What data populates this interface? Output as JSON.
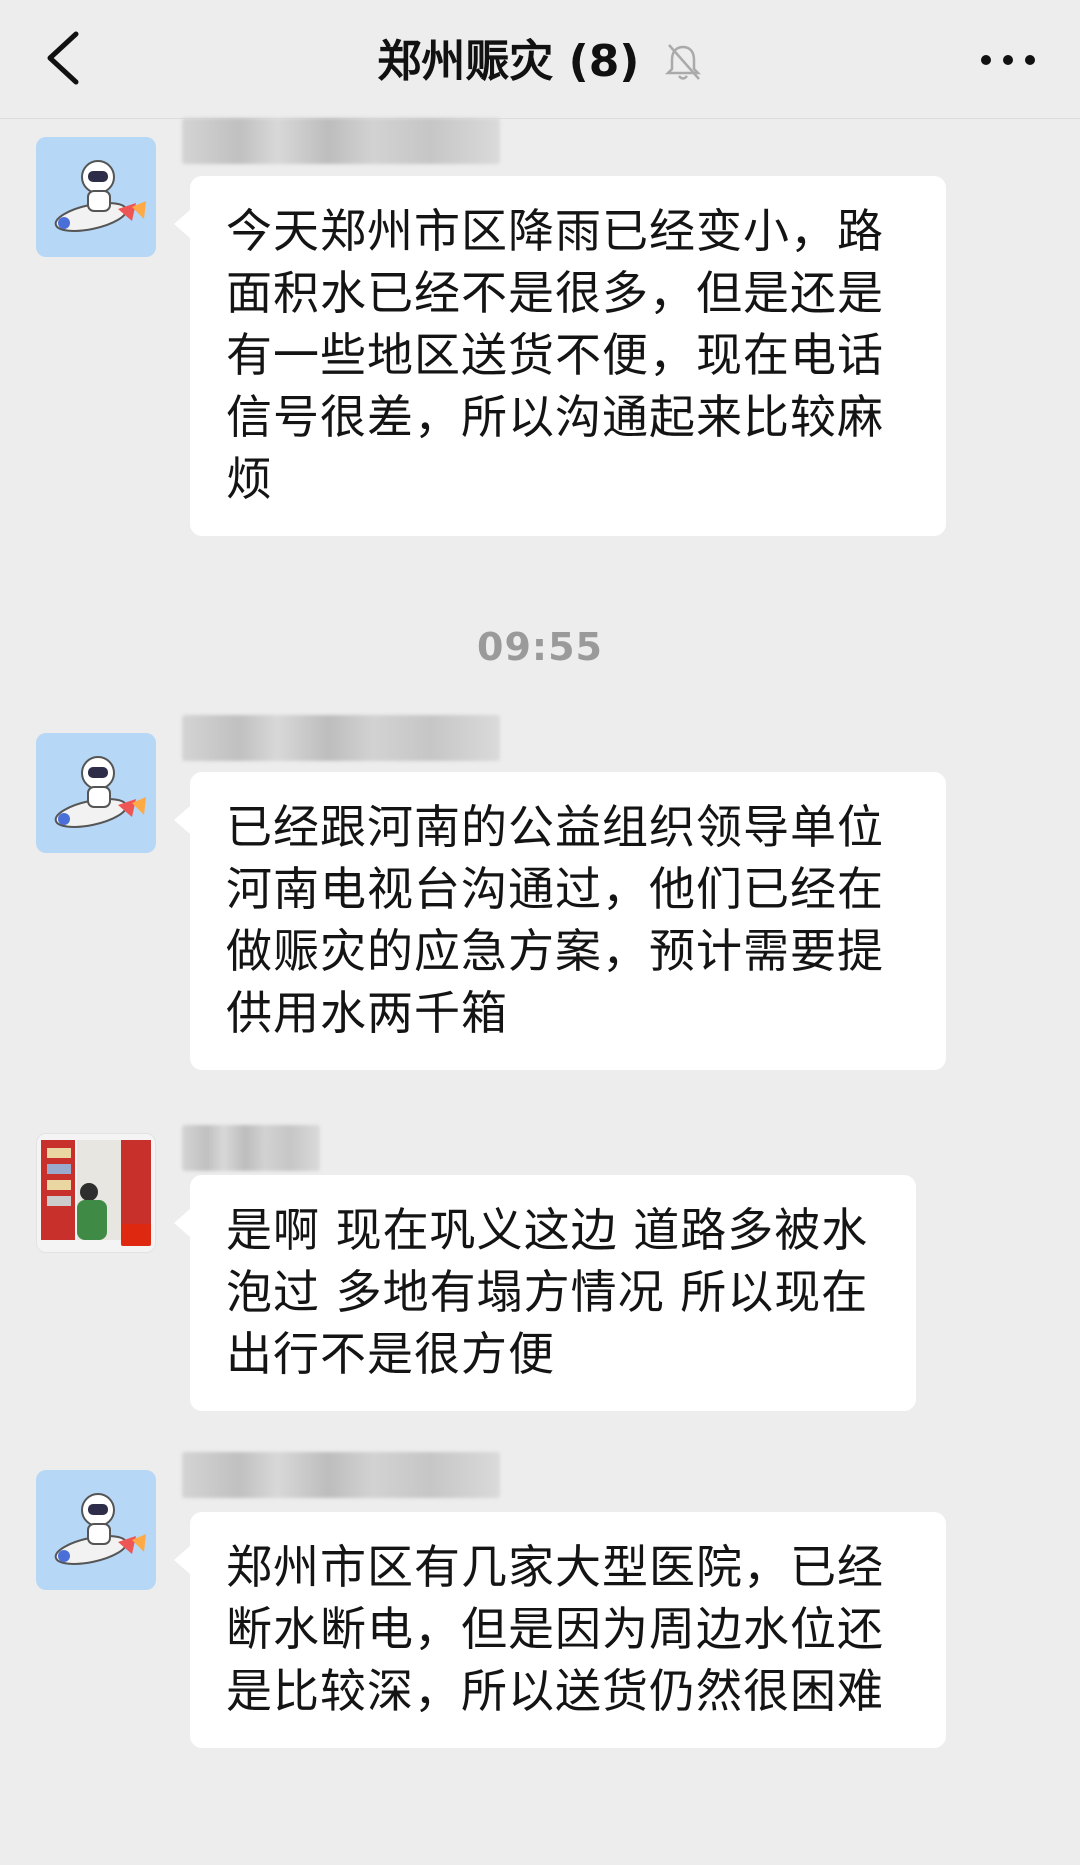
{
  "header": {
    "title": "郑州赈灾",
    "member_count": "(8)",
    "back_icon": "chevron-left-icon",
    "mute_icon": "bell-off-icon",
    "more_icon": "more-horizontal-icon"
  },
  "messages": [
    {
      "avatar": "astronaut-rocket",
      "text": "今天郑州市区降雨已经变小，路面积水已经不是很多，但是还是有一些地区送货不便，现在电话信号很差，所以沟通起来比较麻烦"
    },
    {
      "avatar": "astronaut-rocket",
      "text": "已经跟河南的公益组织领导单位河南电视台沟通过，他们已经在做赈灾的应急方案，预计需要提供用水两千箱"
    },
    {
      "avatar": "photo-with-flag",
      "text": "是啊 现在巩义这边 道路多被水泡过 多地有塌方情况 所以现在出行不是很方便"
    },
    {
      "avatar": "astronaut-rocket",
      "text": "郑州市区有几家大型医院，已经断水断电，但是因为周边水位还是比较深，所以送货仍然很困难"
    }
  ],
  "timestamp": "09:55",
  "colors": {
    "background": "#ededed",
    "bubble": "#ffffff",
    "astronaut_avatar_bg": "#b6d7f6"
  }
}
